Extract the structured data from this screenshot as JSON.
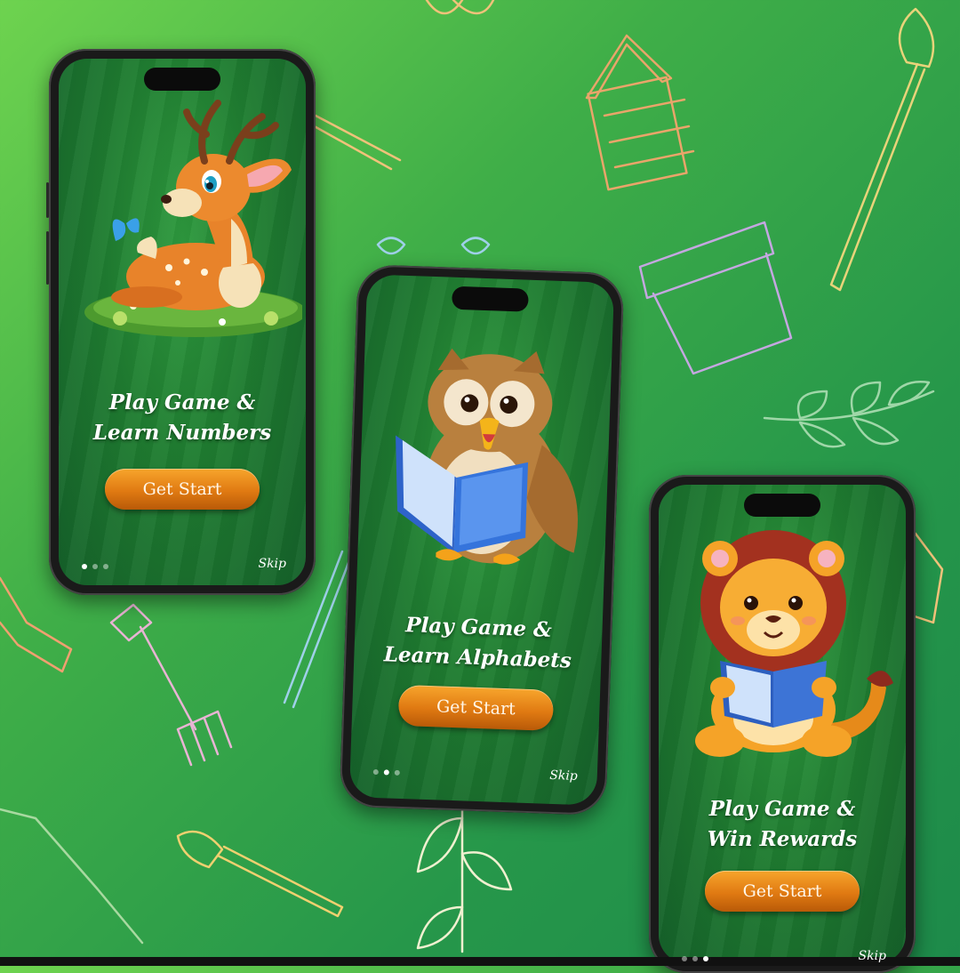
{
  "colors": {
    "background_start": "#6ed34f",
    "background_end": "#1d8a4a",
    "button_orange": "#e07a12",
    "screen_green": "#1f7d31"
  },
  "screens": [
    {
      "headline_line1": "Play Game &",
      "headline_line2": "Learn Numbers",
      "button_label": "Get Start",
      "skip_label": "Skip",
      "character": "deer-illustration",
      "active_dot": 1
    },
    {
      "headline_line1": "Play Game &",
      "headline_line2": "Learn Alphabets",
      "button_label": "Get Start",
      "skip_label": "Skip",
      "character": "owl-illustration",
      "active_dot": 2
    },
    {
      "headline_line1": "Play Game &",
      "headline_line2": "Win Rewards",
      "button_label": "Get Start",
      "skip_label": "Skip",
      "character": "lion-illustration",
      "active_dot": 3
    }
  ],
  "icons": [
    "shovel-icon",
    "house-icon",
    "pot-icon",
    "leaf-icon",
    "rake-icon",
    "trowel-icon"
  ]
}
